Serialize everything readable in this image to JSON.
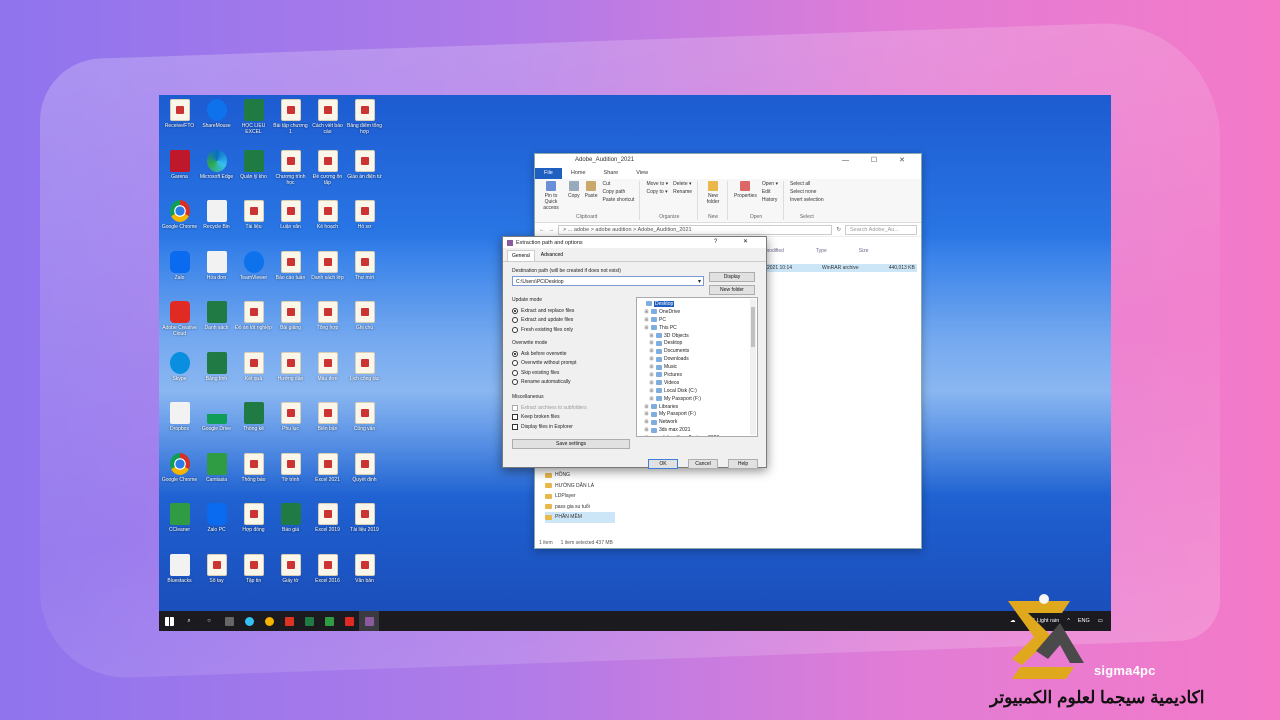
{
  "desktop": {
    "icons": [
      {
        "label": "Receive/FTO",
        "type": "doc"
      },
      {
        "label": "ShareMouse",
        "type": "team"
      },
      {
        "label": "HỌC LIỆU EXCEL",
        "type": "xls"
      },
      {
        "label": "Bài tập chương 1",
        "type": "doc"
      },
      {
        "label": "Cách viết báo cáo",
        "type": "doc"
      },
      {
        "label": "Bảng điểm tổng hợp",
        "type": "doc"
      },
      {
        "label": "Garena",
        "type": "app-red"
      },
      {
        "label": "Microsoft Edge",
        "type": "edge"
      },
      {
        "label": "Quản lý kho",
        "type": "xls"
      },
      {
        "label": "Chương trình học",
        "type": "doc"
      },
      {
        "label": "Đề cương ôn tập",
        "type": "doc"
      },
      {
        "label": "Giáo án điện tử",
        "type": "doc"
      },
      {
        "label": "Google Chrome",
        "type": "chrome"
      },
      {
        "label": "Recycle Bin",
        "type": "white"
      },
      {
        "label": "Tài liệu",
        "type": "doc"
      },
      {
        "label": "Luận văn",
        "type": "doc"
      },
      {
        "label": "Kế hoạch",
        "type": "doc"
      },
      {
        "label": "Hồ sơ",
        "type": "doc"
      },
      {
        "label": "Zalo",
        "type": "zalo"
      },
      {
        "label": "Hóa đơn",
        "type": "white"
      },
      {
        "label": "TeamViewer",
        "type": "team"
      },
      {
        "label": "Báo cáo tuần",
        "type": "doc"
      },
      {
        "label": "Danh sách lớp",
        "type": "doc"
      },
      {
        "label": "Thư mời",
        "type": "doc"
      },
      {
        "label": "Adobe Creative Cloud",
        "type": "acro"
      },
      {
        "label": "Danh sách",
        "type": "xls"
      },
      {
        "label": "Đồ án tốt nghiệp",
        "type": "doc"
      },
      {
        "label": "Bài giảng",
        "type": "doc"
      },
      {
        "label": "Tổng hợp",
        "type": "doc"
      },
      {
        "label": "Ghi chú",
        "type": "doc"
      },
      {
        "label": "Skype",
        "type": "skype"
      },
      {
        "label": "Bảng tính",
        "type": "xls"
      },
      {
        "label": "Kết quả",
        "type": "doc"
      },
      {
        "label": "Hướng dẫn",
        "type": "doc"
      },
      {
        "label": "Mẫu đơn",
        "type": "doc"
      },
      {
        "label": "Lịch công tác",
        "type": "doc"
      },
      {
        "label": "Dropbox",
        "type": "white"
      },
      {
        "label": "Google Drive",
        "type": "gdrive"
      },
      {
        "label": "Thống kê",
        "type": "xls"
      },
      {
        "label": "Phụ lục",
        "type": "doc"
      },
      {
        "label": "Biên bản",
        "type": "doc"
      },
      {
        "label": "Công văn",
        "type": "doc"
      },
      {
        "label": "Google Chrome",
        "type": "chrome"
      },
      {
        "label": "Camtasia",
        "type": "camtasia"
      },
      {
        "label": "Thông báo",
        "type": "doc"
      },
      {
        "label": "Tờ trình",
        "type": "doc"
      },
      {
        "label": "Excel 2021",
        "type": "doc"
      },
      {
        "label": "Quyết định",
        "type": "doc"
      },
      {
        "label": "CCleaner",
        "type": "camtasia"
      },
      {
        "label": "Zalo PC",
        "type": "zalo"
      },
      {
        "label": "Hợp đồng",
        "type": "doc"
      },
      {
        "label": "Báo giá",
        "type": "xls"
      },
      {
        "label": "Excel 2019",
        "type": "doc"
      },
      {
        "label": "Tài liệu 2019",
        "type": "doc"
      },
      {
        "label": "Bluestacks",
        "type": "white"
      },
      {
        "label": "Sổ tay",
        "type": "doc"
      },
      {
        "label": "Tập tin",
        "type": "doc"
      },
      {
        "label": "Giấy tờ",
        "type": "doc"
      },
      {
        "label": "Excel 2016",
        "type": "doc"
      },
      {
        "label": "Văn bản",
        "type": "doc"
      }
    ]
  },
  "explorer": {
    "title": "Adobe_Audition_2021",
    "window_controls": "— ☐ ✕",
    "tabs": [
      "File",
      "Home",
      "Share",
      "View"
    ],
    "ribbon": {
      "clipboard": {
        "name": "Clipboard",
        "pin": "Pin to Quick access",
        "copy": "Copy",
        "paste": "Paste",
        "cut": "Cut",
        "copy_path": "Copy path",
        "paste_shortcut": "Paste shortcut"
      },
      "organize": {
        "name": "Organize",
        "move_to": "Move to ▾",
        "copy_to": "Copy to ▾",
        "delete": "Delete ▾",
        "rename": "Rename"
      },
      "new": {
        "name": "New",
        "new_folder": "New folder"
      },
      "open": {
        "name": "Open",
        "properties": "Properties",
        "open": "Open ▾",
        "edit": "Edit",
        "history": "History"
      },
      "select": {
        "name": "Select",
        "select_all": "Select all",
        "select_none": "Select none",
        "invert": "Invert selection"
      }
    },
    "address": "> ... adobe > adobe audition > Adobe_Audition_2021",
    "search_placeholder": "Search Adobe_Au...",
    "columns": [
      "modified",
      "Type",
      "Size"
    ],
    "file_row": {
      "modified": "2021 10:14",
      "type": "WinRAR archive",
      "size": "440,013 KB"
    },
    "nav_items": [
      "HỒNG",
      "HƯỚNG DẪN LÀ",
      "LDPlayer",
      "pass gia su tuổi",
      "PHẦN MỀM"
    ],
    "status_items": "1 item",
    "status_selected": "1 item selected  437 MB"
  },
  "dialog": {
    "title": "Extraction path and options",
    "title_controls": "? ✕",
    "tabs": [
      "General",
      "Advanced"
    ],
    "dest_label": "Destination path (will be created if does not exist)",
    "dest_value": "C:\\Users\\PC\\Desktop",
    "display_btn": "Display",
    "new_folder_btn": "New folder",
    "update_mode": {
      "title": "Update mode",
      "options": [
        "Extract and replace files",
        "Extract and update files",
        "Fresh existing files only"
      ],
      "selected": 0
    },
    "overwrite_mode": {
      "title": "Overwrite mode",
      "options": [
        "Ask before overwrite",
        "Overwrite without prompt",
        "Skip existing files",
        "Rename automatically"
      ],
      "selected": 0
    },
    "misc": {
      "title": "Miscellaneous",
      "options": [
        "Extract archives to subfolders",
        "Keep broken files",
        "Display files in Explorer"
      ]
    },
    "save_settings": "Save settings",
    "tree": [
      "Desktop",
      "OneDrive",
      "PC",
      "This PC",
      "3D Objects",
      "Desktop",
      "Documents",
      "Downloads",
      "Music",
      "Pictures",
      "Videos",
      "Local Disk (C:)",
      "My Passport (F:)",
      "Libraries",
      "My Passport (F:)",
      "Network",
      "3ds max 2021",
      "adobe after effects cc 2020"
    ],
    "ok_btn": "OK",
    "cancel_btn": "Cancel",
    "help_btn": "Help"
  },
  "taskbar": {
    "weather": "89°F  Light rain",
    "lang": "ENG"
  },
  "brand": {
    "name": "sigma4pc",
    "arabic": "اكاديمية سيجما لعلوم الكمبيوتر"
  },
  "colors": {
    "accent": "#1f5fbf",
    "logo_gold": "#e0a81c"
  }
}
